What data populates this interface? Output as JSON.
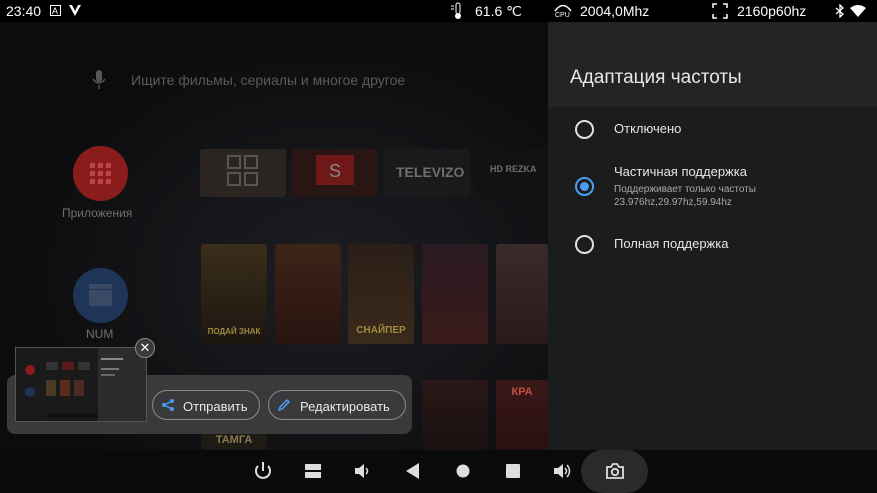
{
  "status_bar": {
    "time": "23:40",
    "temperature": "61.6 ℃",
    "cpu_label": "CPU",
    "cpu_freq": "2004,0Mhz",
    "resolution": "2160p60hz"
  },
  "launcher": {
    "search_placeholder": "Ищите фильмы, сериалы и многое другое",
    "apps_label": "Приложения",
    "num_label": "NUM",
    "tiles": [
      "TELEVIZO",
      "HD REZKA"
    ],
    "poster_captions": [
      "ПОДАЙ ЗНАК",
      "СНАЙПЕР",
      "ТАМГА",
      "КРА"
    ]
  },
  "settings_panel": {
    "title": "Адаптация частоты",
    "options": [
      {
        "label": "Отключено",
        "selected": false
      },
      {
        "label": "Частичная поддержка",
        "description": "Поддерживает только частоты 23.976hz,29.97hz,59.94hz",
        "selected": true
      },
      {
        "label": "Полная поддержка",
        "selected": false
      }
    ]
  },
  "screenshot_share": {
    "close_label": "✕",
    "send_label": "Отправить",
    "edit_label": "Редактировать"
  },
  "colors": {
    "accent": "#4a9df0",
    "panel_bg": "#1b1c1e",
    "header_bg": "#232426"
  }
}
